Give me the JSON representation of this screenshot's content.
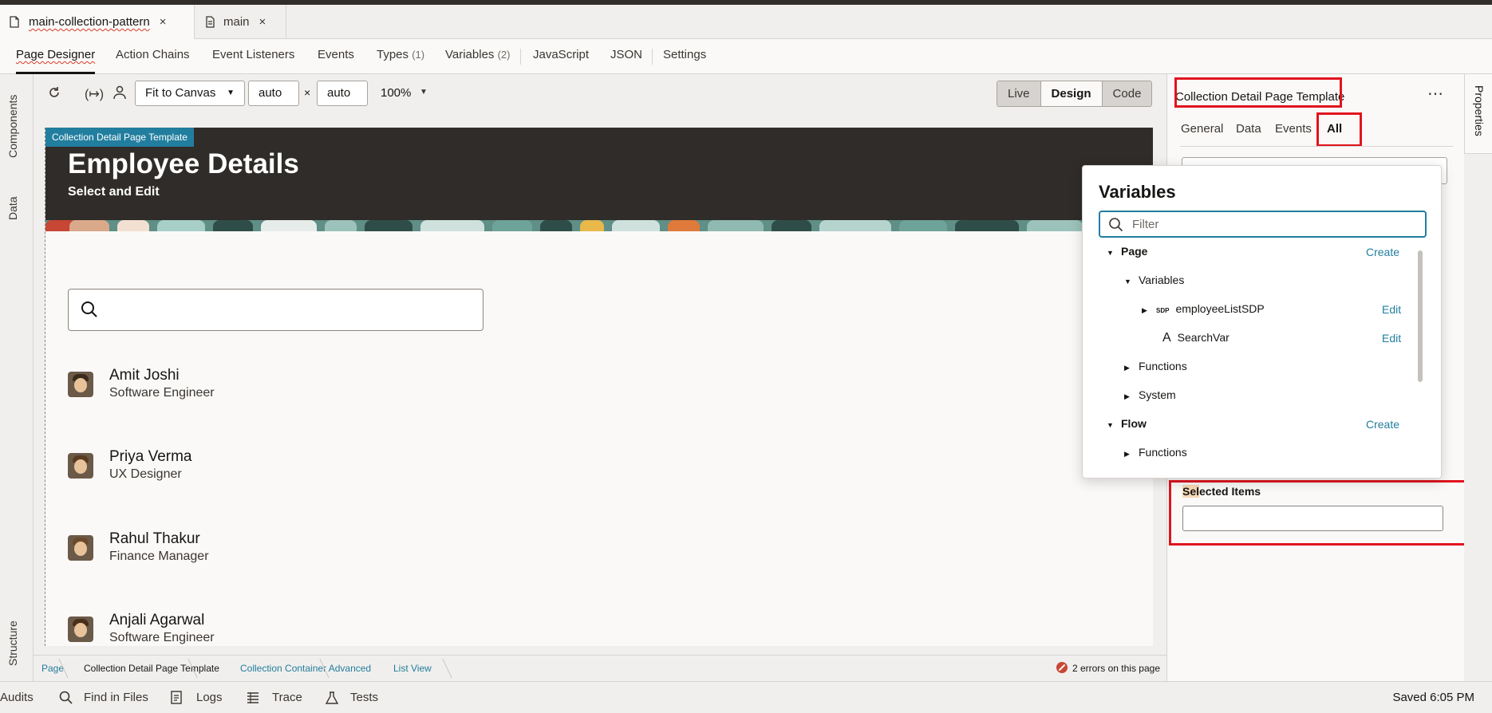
{
  "file_tabs": [
    {
      "label": "main-collection-pattern",
      "active": true
    },
    {
      "label": "main",
      "active": false
    }
  ],
  "designer_tabs": [
    {
      "label": "Page Designer",
      "count": ""
    },
    {
      "label": "Action Chains",
      "count": ""
    },
    {
      "label": "Event Listeners",
      "count": ""
    },
    {
      "label": "Events",
      "count": ""
    },
    {
      "label": "Types",
      "count": "(1)"
    },
    {
      "label": "Variables",
      "count": "(2)"
    },
    {
      "label": "JavaScript",
      "count": ""
    },
    {
      "label": "JSON",
      "count": ""
    },
    {
      "label": "Settings",
      "count": ""
    }
  ],
  "left_strip": {
    "components": "Components",
    "data": "Data",
    "structure": "Structure"
  },
  "toolbar": {
    "fit": "Fit to Canvas",
    "width": "auto",
    "times": "×",
    "height": "auto",
    "zoom": "100%",
    "modes": [
      "Live",
      "Design",
      "Code"
    ],
    "active_mode": "Design"
  },
  "canvas": {
    "template_badge": "Collection Detail Page Template",
    "title": "Employee Details",
    "subtitle": "Select and Edit",
    "employees": [
      {
        "name": "Amit Joshi",
        "role": "Software Engineer"
      },
      {
        "name": "Priya Verma",
        "role": "UX Designer"
      },
      {
        "name": "Rahul Thakur",
        "role": "Finance Manager"
      },
      {
        "name": "Anjali Agarwal",
        "role": "Software Engineer"
      }
    ]
  },
  "breadcrumb": {
    "items": [
      "Page",
      "Collection Detail Page Template",
      "Collection Container Advanced",
      "List View"
    ],
    "errors": "2 errors on this page"
  },
  "properties": {
    "title": "Collection Detail Page Template",
    "more": "⋯",
    "tabs": [
      "General",
      "Data",
      "Events",
      "All"
    ],
    "active_tab": "All",
    "selected_items_label_hl": "Sel",
    "selected_items_label_rest": "ected Items",
    "side_tab": "Properties"
  },
  "variables_popup": {
    "title": "Variables",
    "filter_placeholder": "Filter",
    "page": "Page",
    "page_create": "Create",
    "variables": "Variables",
    "var1": "employeeListSDP",
    "var1_type": "SDP",
    "var1_edit": "Edit",
    "var2": "SearchVar",
    "var2_type": "A",
    "var2_edit": "Edit",
    "functions": "Functions",
    "system": "System",
    "flow": "Flow",
    "flow_create": "Create",
    "flow_functions": "Functions"
  },
  "statusbar": {
    "audits": "Audits",
    "find": "Find in Files",
    "logs": "Logs",
    "trace": "Trace",
    "tests": "Tests",
    "saved": "Saved 6:05 PM"
  },
  "colors": {
    "accent": "#227e9e",
    "highlight_box": "#e0141e",
    "hero_bg": "#2f2c29"
  }
}
